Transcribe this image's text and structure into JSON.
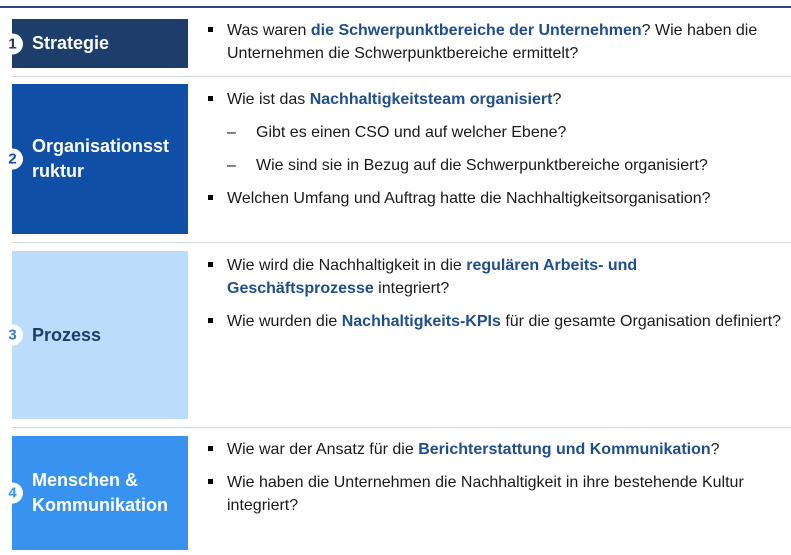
{
  "sections": [
    {
      "number": "1",
      "title": "Strategie",
      "bullets": [
        {
          "pre": "Was waren ",
          "hl": "die Schwerpunktbereiche der Unternehmen",
          "post": "? Wie haben die Unternehmen die Schwerpunktbereiche ermittelt?"
        }
      ]
    },
    {
      "number": "2",
      "title_line1": "Organisationsst",
      "title_line2": "ruktur",
      "bullet1": {
        "pre": "Wie ist das ",
        "hl": "Nachhaltigkeitsteam organisiert",
        "post": "?"
      },
      "dash_mark": "–",
      "sub1": "Gibt es einen CSO und auf welcher Ebene?",
      "sub2": "Wie sind sie in Bezug auf die Schwerpunktbereiche organisiert?",
      "bullet2": "Welchen Umfang und Auftrag hatte die Nachhaltigkeitsorganisation?"
    },
    {
      "number": "3",
      "title": "Prozess",
      "bullet1": {
        "pre": "Wie wird die Nachhaltigkeit in die ",
        "hl": "regulären Arbeits- und Geschäftsprozesse",
        "post": " integriert?"
      },
      "bullet2": {
        "pre": "Wie wurden die ",
        "hl": "Nachhaltigkeits-KPIs",
        "post": " für die gesamte Organisation definiert?"
      }
    },
    {
      "number": "4",
      "title_line1": "Menschen &",
      "title_line2": "Kommunikation",
      "bullet1": {
        "pre": "Wie war der Ansatz für die ",
        "hl": "Berichterstattung und Kommunikation",
        "post": "?"
      },
      "bullet2": "Wie haben die Unternehmen die Nachhaltigkeit in ihre bestehende Kultur integriert?"
    }
  ]
}
